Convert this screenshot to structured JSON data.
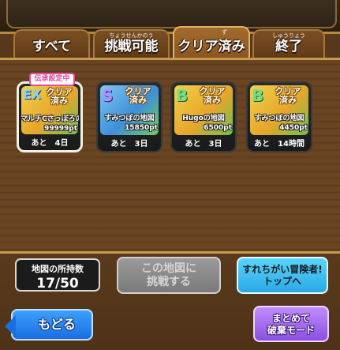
{
  "tabs": [
    {
      "label": "すべて",
      "ruby": "",
      "active": false
    },
    {
      "label": "挑戦可能",
      "ruby": "ちょうせんかのう",
      "active": false
    },
    {
      "label": "クリア済み",
      "ruby": "ず",
      "active": true
    },
    {
      "label": "終了",
      "ruby": "しゅうりょう",
      "active": false
    }
  ],
  "inherit_tag": "伝承設定中",
  "cards": [
    {
      "rank": "EX",
      "status": "クリア\n済み",
      "name": "マルチCさっぽろの地図",
      "pt": "99999pt",
      "remaining": "あと　4日",
      "selected": true
    },
    {
      "rank": "S",
      "status": "クリア\n済み",
      "name": "すみつぼの地図",
      "pt": "15850pt",
      "remaining": "あと　3日",
      "selected": false
    },
    {
      "rank": "B",
      "status": "クリア\n済み",
      "name": "Hugoの地図",
      "pt": "6500pt",
      "remaining": "あと　3日",
      "selected": false
    },
    {
      "rank": "B",
      "status": "クリア\n済み",
      "name": "すみつぼの地図",
      "pt": "4450pt",
      "remaining": "あと　14時間",
      "selected": false
    }
  ],
  "map_count": {
    "label": "地図の所持数",
    "value": "17/50"
  },
  "buttons": {
    "challenge": "この地図に\n挑戦する",
    "encounter": "すれちがい冒険者!\nトップへ",
    "back": "もどる",
    "bulk_discard": "まとめて\n破棄モード"
  }
}
